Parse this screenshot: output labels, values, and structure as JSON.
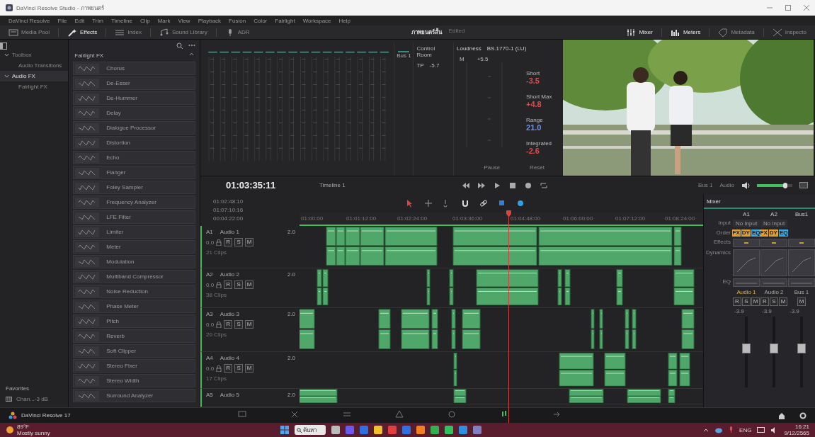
{
  "window": {
    "title": "DaVinci Resolve Studio - ภาพยนตร์"
  },
  "menu": [
    "DaVinci Resolve",
    "File",
    "Edit",
    "Trim",
    "Timeline",
    "Clip",
    "Mark",
    "View",
    "Playback",
    "Fusion",
    "Color",
    "Fairlight",
    "Workspace",
    "Help"
  ],
  "toolbar": {
    "left": [
      {
        "label": "Media Pool",
        "selected": false
      },
      {
        "label": "Effects",
        "selected": true
      },
      {
        "label": "Index",
        "selected": false
      },
      {
        "label": "Sound Library",
        "selected": false
      },
      {
        "label": "ADR",
        "selected": false
      }
    ],
    "project": {
      "name": "ภาพยนตร์สั้น",
      "status": "Edited"
    },
    "right": [
      {
        "label": "Mixer",
        "selected": true
      },
      {
        "label": "Meters",
        "selected": true
      },
      {
        "label": "Metadata",
        "selected": false
      },
      {
        "label": "Inspecto",
        "selected": false
      }
    ]
  },
  "tree": [
    {
      "label": "Toolbox",
      "expanded": true,
      "selected": false,
      "children": [
        {
          "label": "Audio Transitions",
          "selected": false
        }
      ]
    },
    {
      "label": "Audio FX",
      "expanded": true,
      "selected": true,
      "children": [
        {
          "label": "Fairlight FX",
          "selected": false
        }
      ]
    }
  ],
  "favorites": {
    "title": "Favorites",
    "items": [
      "Chan...-3 dB"
    ]
  },
  "fx_list": {
    "title": "Fairlight FX",
    "items": [
      "Chorus",
      "De-Esser",
      "De-Hummer",
      "Delay",
      "Dialogue Processor",
      "Distortion",
      "Echo",
      "Flanger",
      "Foley Sampler",
      "Frequency Analyzer",
      "LFE Filter",
      "Limiter",
      "Meter",
      "Modulation",
      "Multiband Compressor",
      "Noise Reduction",
      "Phase Meter",
      "Pitch",
      "Reverb",
      "Soft Clipper",
      "Stereo Fixer",
      "Stereo Width",
      "Surround Analyzer"
    ]
  },
  "meters": {
    "bus": "Bus 1",
    "control_room": {
      "title": "Control Room",
      "tp_label": "TP",
      "tp_value": "-5.7"
    },
    "loudness": {
      "title": "Loudness",
      "standard": "BS.1770-1 (LU)",
      "m_label": "M",
      "m_value": "+5.5",
      "readings": [
        {
          "label": "Short",
          "value": "-3.5",
          "color": "#e04a4a"
        },
        {
          "label": "Short Max",
          "value": "+4.8",
          "color": "#e04a4a"
        },
        {
          "label": "Range",
          "value": "21.0",
          "color": "#6f8df0"
        },
        {
          "label": "Integrated",
          "value": "-2.6",
          "color": "#e04a4a"
        }
      ],
      "buttons": [
        "Pause",
        "Reset"
      ]
    }
  },
  "transport": {
    "timecode": "01:03:35:11",
    "timeline": "Timeline 1",
    "route": "Bus 1",
    "route_target": "Audio",
    "volume": {
      "level": 0.8
    }
  },
  "timeline": {
    "timecodes": [
      "01:02:48:10",
      "01:07:10:16",
      "00:04:22:00"
    ],
    "ruler": [
      "01:00:00",
      "01:01:12:00",
      "01:02:24:00",
      "01:03:36:00",
      "01:04:48:00",
      "01:06:00:00",
      "01:07:12:00",
      "01:08:24:00"
    ],
    "tracks": [
      {
        "id": "A1",
        "name": "Audio 1",
        "format": "2.0",
        "volume": "0.0",
        "buttons": [
          "R",
          "S",
          "M"
        ],
        "clips": "21 Clips"
      },
      {
        "id": "A2",
        "name": "Audio 2",
        "format": "2.0",
        "volume": "0.0",
        "buttons": [
          "R",
          "S",
          "M"
        ],
        "clips": "38 Clips"
      },
      {
        "id": "A3",
        "name": "Audio 3",
        "format": "2.0",
        "volume": "0.0",
        "buttons": [
          "R",
          "S",
          "M"
        ],
        "clips": "20 Clips"
      },
      {
        "id": "A4",
        "name": "Audio 4",
        "format": "2.0",
        "volume": "0.0",
        "buttons": [
          "R",
          "S",
          "M"
        ],
        "clips": "17 Clips"
      },
      {
        "id": "A5",
        "name": "Audio 5",
        "format": "2.0"
      }
    ]
  },
  "mixer": {
    "title": "Mixer",
    "row_labels": [
      "Input",
      "Order",
      "Effects",
      "Dynamics",
      "EQ"
    ],
    "channels": [
      {
        "header": "A1",
        "input": "No Input",
        "order": [
          {
            "label": "FX",
            "color": "#e0a030"
          },
          {
            "label": "DY",
            "color": "#e0a030"
          },
          {
            "label": "EQ",
            "color": "#3aa8e0"
          }
        ],
        "name": "Audio 1",
        "selected": true,
        "buttons": [
          "R",
          "S",
          "M"
        ],
        "reading": "-3.9",
        "level": 0.55
      },
      {
        "header": "A2",
        "input": "No Input",
        "order": [
          {
            "label": "FX",
            "color": "#e0a030"
          },
          {
            "label": "DY",
            "color": "#e0a030"
          },
          {
            "label": "EQ",
            "color": "#3aa8e0"
          }
        ],
        "name": "Audio 2",
        "selected": false,
        "buttons": [
          "R",
          "S",
          "M"
        ],
        "reading": "-3.9",
        "level": 0.55
      },
      {
        "header": "Bus1",
        "name": "Bus 1",
        "selected": false,
        "buttons": [
          "M"
        ],
        "reading": "-3.9",
        "level": 0.55
      }
    ]
  },
  "page_bar": {
    "app": "DaVinci Resolve 17"
  },
  "taskbar": {
    "temp": "89°F",
    "weather": "Mostly sunny",
    "search": "ค้นหา",
    "lang": "ENG",
    "time": "16:21",
    "date": "9/12/2565"
  }
}
